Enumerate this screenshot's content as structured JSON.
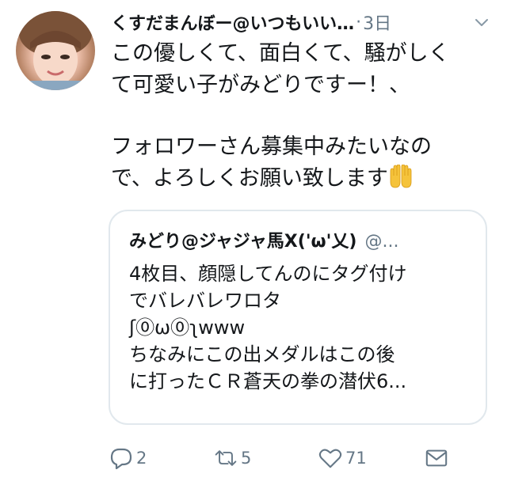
{
  "tweet": {
    "display_name": "くすだまんぼー@いつもいい…",
    "separator": "·",
    "time": "3日",
    "body_lines": [
      "この優しくて、面白くて、騒がしく",
      "て可愛い子がみどりですー！、",
      "",
      "フォロワーさん募集中みたいなの",
      "で、よろしくお願い致します"
    ],
    "body_emoji": "raised-hands-emoji"
  },
  "quoted": {
    "display_name": "みどり@ジャジャ馬X('ω'乂)",
    "handle": "@...",
    "body_lines": [
      "4枚目、顔隠してんのにタグ付け",
      "でバレバレワロタ",
      "ʃ⓪ω⓪ʅwww",
      "ちなみにこの出メダルはこの後",
      "に打ったＣＲ蒼天の拳の潜伏6..."
    ]
  },
  "actions": {
    "reply_count": "2",
    "retweet_count": "5",
    "like_count": "71"
  },
  "colors": {
    "text": "#14171a",
    "muted": "#657786",
    "border": "#e1e8ed",
    "emoji": "#f5c33b"
  },
  "icons": [
    "chevron-down-icon",
    "reply-icon",
    "retweet-icon",
    "heart-icon",
    "envelope-icon"
  ]
}
